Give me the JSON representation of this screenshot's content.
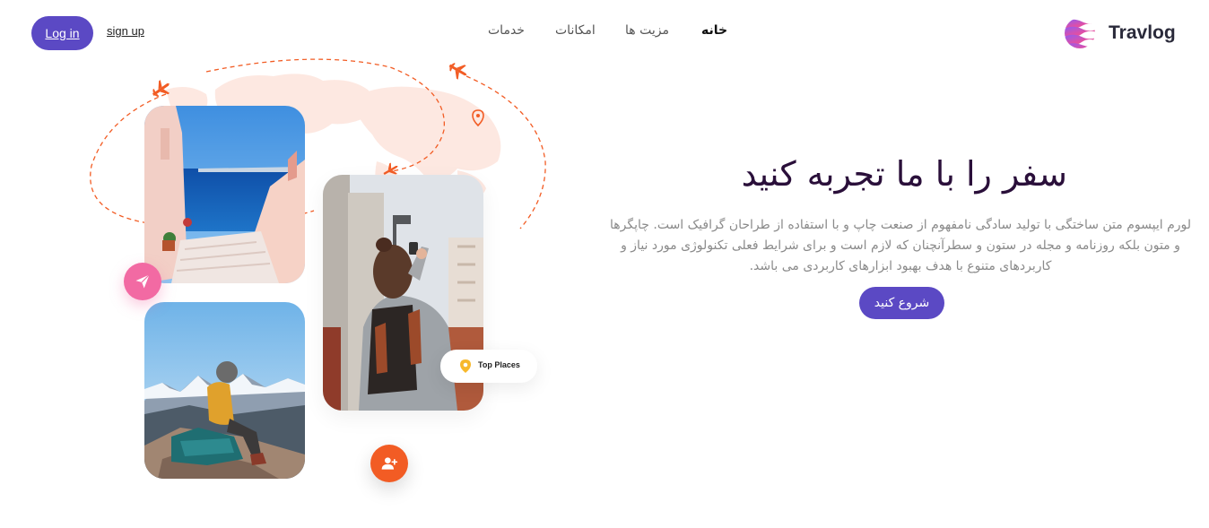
{
  "header": {
    "login_label": "Log in",
    "signup_label": "sign up",
    "nav": [
      {
        "label": "خدمات",
        "active": false
      },
      {
        "label": "امکانات",
        "active": false
      },
      {
        "label": "مزیت ها",
        "active": false
      },
      {
        "label": "خانه",
        "active": true
      }
    ],
    "logo_text": "Travlog"
  },
  "hero": {
    "title": "سفر را با ما تجربه کنید",
    "description": "لورم ایپسوم متن ساختگی با تولید سادگی نامفهوم از صنعت چاپ و با استفاده از طراحان گرافیک است. چاپگرها و متون بلکه روزنامه و مجله در ستون و سطرآنچنان که لازم است و برای شرایط فعلی تکنولوژی مورد نیاز و کاربردهای متنوع با هدف بهبود ابزارهای کاربردی می باشد.",
    "cta_label": "شروع کنید"
  },
  "illustration": {
    "top_places_label": "Top Places",
    "icons": [
      "airplane-icon",
      "airplane-icon",
      "airplane-icon",
      "map-pin-icon",
      "send-icon",
      "user-plus-icon",
      "location-pin-icon"
    ]
  },
  "colors": {
    "primary": "#5b49c4",
    "accent_orange": "#f25c24",
    "accent_pink": "#f26aa3",
    "title": "#2a0f3a",
    "body_text": "#8a8a8a",
    "map_fill": "#fde4dc"
  }
}
